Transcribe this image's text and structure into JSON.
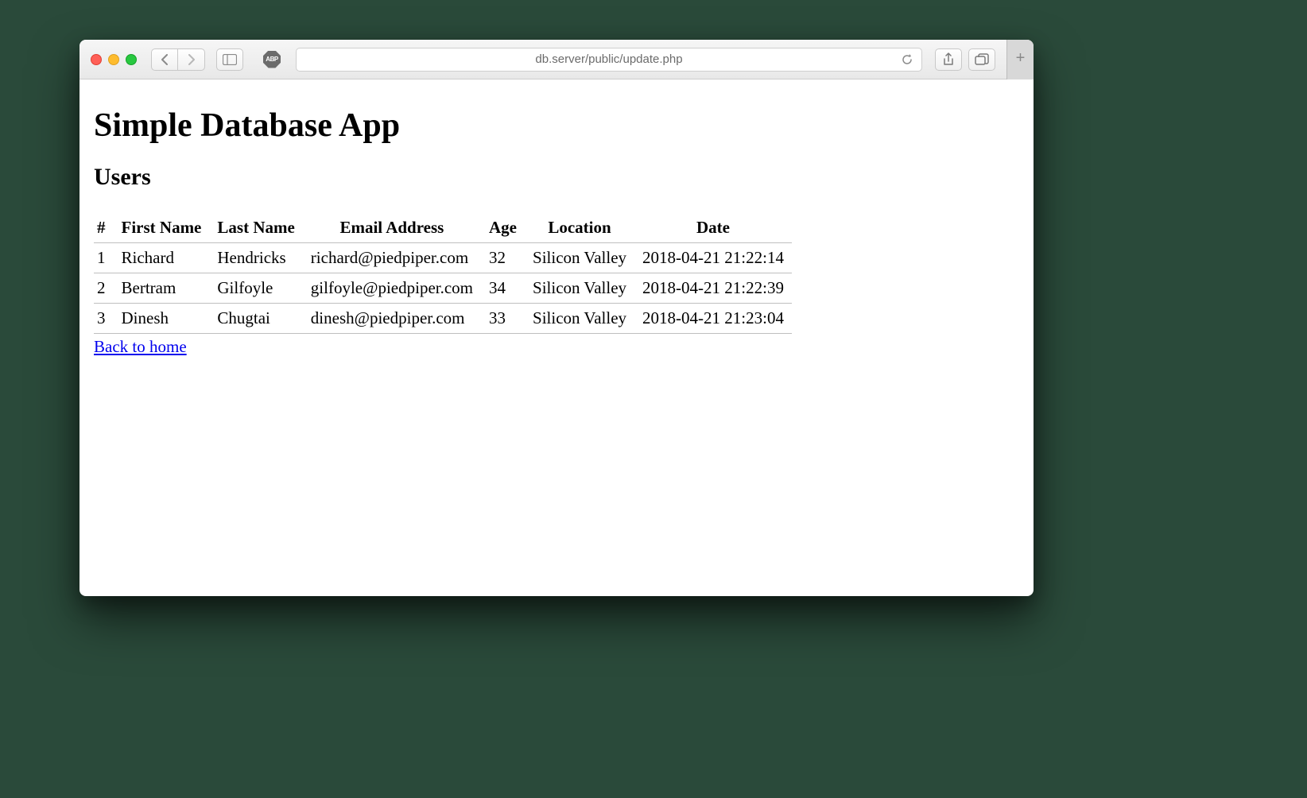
{
  "browser": {
    "url": "db.server/public/update.php",
    "abp_label": "ABP"
  },
  "page": {
    "title": "Simple Database App",
    "subtitle": "Users",
    "back_link": "Back to home",
    "columns": {
      "id": "#",
      "first_name": "First Name",
      "last_name": "Last Name",
      "email": "Email Address",
      "age": "Age",
      "location": "Location",
      "date": "Date"
    },
    "rows": [
      {
        "id": "1",
        "first_name": "Richard",
        "last_name": "Hendricks",
        "email": "richard@piedpiper.com",
        "age": "32",
        "location": "Silicon Valley",
        "date": "2018-04-21 21:22:14"
      },
      {
        "id": "2",
        "first_name": "Bertram",
        "last_name": "Gilfoyle",
        "email": "gilfoyle@piedpiper.com",
        "age": "34",
        "location": "Silicon Valley",
        "date": "2018-04-21 21:22:39"
      },
      {
        "id": "3",
        "first_name": "Dinesh",
        "last_name": "Chugtai",
        "email": "dinesh@piedpiper.com",
        "age": "33",
        "location": "Silicon Valley",
        "date": "2018-04-21 21:23:04"
      }
    ]
  }
}
